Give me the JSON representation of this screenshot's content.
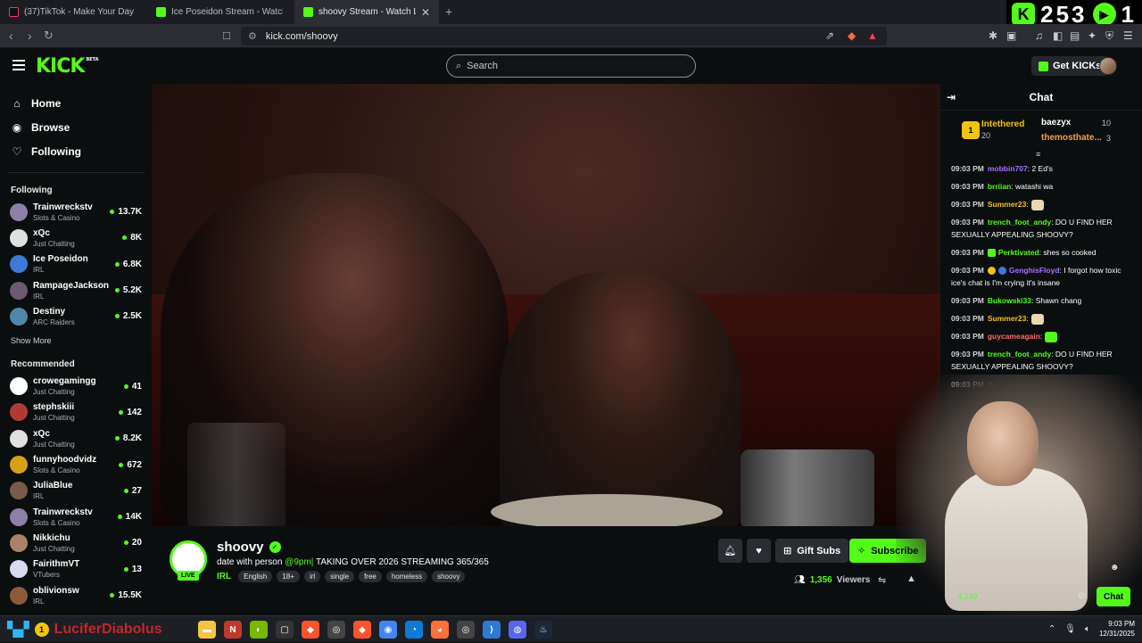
{
  "browser": {
    "tabs": [
      {
        "title": "(37)TikTok - Make Your Day",
        "active": false,
        "favicon": "tiktok-icon"
      },
      {
        "title": "Ice Poseidon Stream - Watch Live",
        "active": false,
        "favicon": "kick-icon"
      },
      {
        "title": "shoovy Stream - Watch Live",
        "active": true,
        "favicon": "kick-icon"
      }
    ],
    "url": "kick.com/shoovy",
    "overlay_counter": "253"
  },
  "header": {
    "logo": "KICK",
    "logo_sup": "BETA",
    "search_placeholder": "Search",
    "get_kicks_label": "Get KICKs"
  },
  "sidebar": {
    "nav": [
      {
        "label": "Home",
        "icon": "home-icon"
      },
      {
        "label": "Browse",
        "icon": "compass-icon"
      },
      {
        "label": "Following",
        "icon": "heart-icon"
      }
    ],
    "following_heading": "Following",
    "following": [
      {
        "name": "Trainwreckstv",
        "category": "Slots & Casino",
        "viewers": "13.7K",
        "color": "#8e7fa8"
      },
      {
        "name": "xQc",
        "category": "Just Chatting",
        "viewers": "8K",
        "color": "#e0e0e0"
      },
      {
        "name": "Ice Poseidon",
        "category": "IRL",
        "viewers": "6.8K",
        "color": "#3b7bd6"
      },
      {
        "name": "RampageJackson",
        "category": "IRL",
        "viewers": "5.2K",
        "color": "#6e5a70"
      },
      {
        "name": "Destiny",
        "category": "ARC Raiders",
        "viewers": "2.5K",
        "color": "#4e87a8"
      }
    ],
    "show_more_label": "Show More",
    "recommended_heading": "Recommended",
    "recommended": [
      {
        "name": "crowegamingg",
        "category": "Just Chatting",
        "viewers": "41",
        "color": "#ffffff"
      },
      {
        "name": "stephskiii",
        "category": "Just Chatting",
        "viewers": "142",
        "color": "#b33939"
      },
      {
        "name": "xQc",
        "category": "Just Chatting",
        "viewers": "8.2K",
        "color": "#e0e0e0"
      },
      {
        "name": "funnyhoodvidz",
        "category": "Slots & Casino",
        "viewers": "672",
        "color": "#d4a017"
      },
      {
        "name": "JuliaBlue",
        "category": "IRL",
        "viewers": "27",
        "color": "#7a5a4a"
      },
      {
        "name": "Trainwreckstv",
        "category": "Slots & Casino",
        "viewers": "14K",
        "color": "#8e7fa8"
      },
      {
        "name": "Nikkichu",
        "category": "Just Chatting",
        "viewers": "20",
        "color": "#a8836a"
      },
      {
        "name": "FairithmVT",
        "category": "VTubers",
        "viewers": "13",
        "color": "#d9d9f0"
      },
      {
        "name": "oblivionsw",
        "category": "IRL",
        "viewers": "15.5K",
        "color": "#8c5a3c"
      }
    ]
  },
  "stream": {
    "streamer": "shoovy",
    "live_label": "LIVE",
    "title_prefix": "date with person ",
    "title_highlight": "@9pm|",
    "title_suffix": " TAKING OVER 2026 STREAMING 365/365",
    "category": "IRL",
    "tags": [
      "English",
      "18+",
      "irl",
      "single",
      "free",
      "homeless",
      "shoovy"
    ],
    "gift_label": "Gift Subs",
    "subscribe_label": "Subscribe",
    "viewers_count": "1,356",
    "viewers_label": "Viewers"
  },
  "chat": {
    "title": "Chat",
    "leaderboard": {
      "first": {
        "name": "Intethered",
        "value": "20",
        "rank": "1"
      },
      "second": {
        "name": "baezyx",
        "value": "10"
      },
      "third": {
        "name": "themosthate...",
        "value": "3"
      }
    },
    "messages": [
      {
        "time": "09:03 PM",
        "user": "mobbin707",
        "color": "#a970ff",
        "text": ": 2 Ed's"
      },
      {
        "time": "09:03 PM",
        "user": "brriian",
        "color": "#53fc18",
        "text": ": watashi wa"
      },
      {
        "time": "09:03 PM",
        "user": "Summer23",
        "color": "#f1c40f",
        "text": ":"
      },
      {
        "time": "09:03 PM",
        "user": "trench_foot_andy",
        "color": "#53fc18",
        "text": ": DO U FIND HER SEXUALLY APPEALING SHOOVY?"
      },
      {
        "time": "09:03 PM",
        "user": "Perktivated",
        "color": "#53fc18",
        "text": ": shes so cooked"
      },
      {
        "time": "09:03 PM",
        "user": "GenghisFloyd",
        "color": "#a970ff",
        "text": ": I forgot how toxic ice's chat is I'm crying it's insane"
      },
      {
        "time": "09:03 PM",
        "user": "Bukowski33",
        "color": "#53fc18",
        "text": ": Shawn chang"
      },
      {
        "time": "09:03 PM",
        "user": "Summer23",
        "color": "#f1c40f",
        "text": ":"
      },
      {
        "time": "09:03 PM",
        "user": "guycameagain",
        "color": "#ff6b6b",
        "text": ":"
      },
      {
        "time": "09:03 PM",
        "user": "trench_foot_andy",
        "color": "#53fc18",
        "text": ": DO U FIND HER SEXUALLY APPEALING SHOOVY?"
      },
      {
        "time": "09:03 PM",
        "user": "Summer23",
        "color": "#f1c40f",
        "text": ":"
      }
    ],
    "points": "4,230",
    "chat_button_label": "Chat"
  },
  "taskbar": {
    "overlay_text": "LuciferDiabolus",
    "apps": [
      "folder-icon",
      "news-icon",
      "nvidia-icon",
      "terminal-icon",
      "brave-icon",
      "obs-icon",
      "brave-icon",
      "chrome-icon",
      "edge-icon",
      "firefox-icon",
      "obs-icon",
      "vscode-icon",
      "discord-icon",
      "steam-icon"
    ],
    "time": "9:03 PM",
    "date": "12/31/2025"
  },
  "colors": {
    "accent": "#53fc18",
    "background": "#0b0e0f"
  }
}
